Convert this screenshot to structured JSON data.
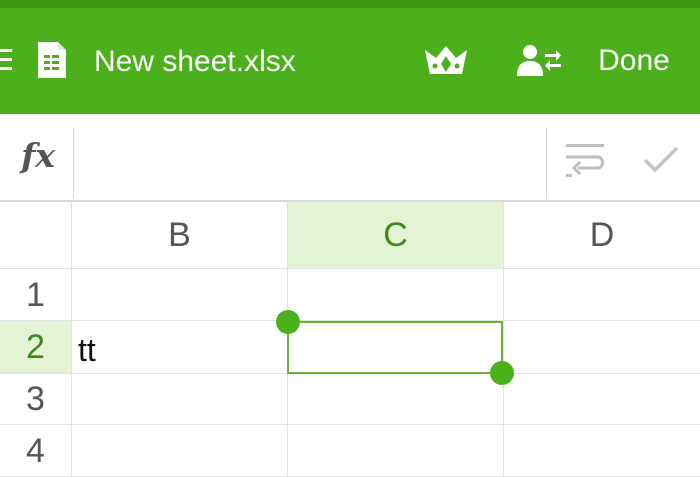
{
  "app": {
    "file_title": "New sheet.xlsx",
    "done_label": "Done",
    "accent_color": "#4caf1c",
    "icons": [
      "menu-icon",
      "spreadsheet-file-icon",
      "crown-premium-icon",
      "share-user-icon",
      "fx-icon",
      "wrap-text-icon",
      "checkmark-icon"
    ]
  },
  "formula_bar": {
    "fx_label": "fx",
    "value": ""
  },
  "sheet": {
    "columns": [
      "B",
      "C",
      "D"
    ],
    "selected_column": "C",
    "rows": [
      "1",
      "2",
      "3",
      "4"
    ],
    "selected_row": "2",
    "cells": {
      "B2": "tt"
    },
    "selected_cell": "C2"
  }
}
